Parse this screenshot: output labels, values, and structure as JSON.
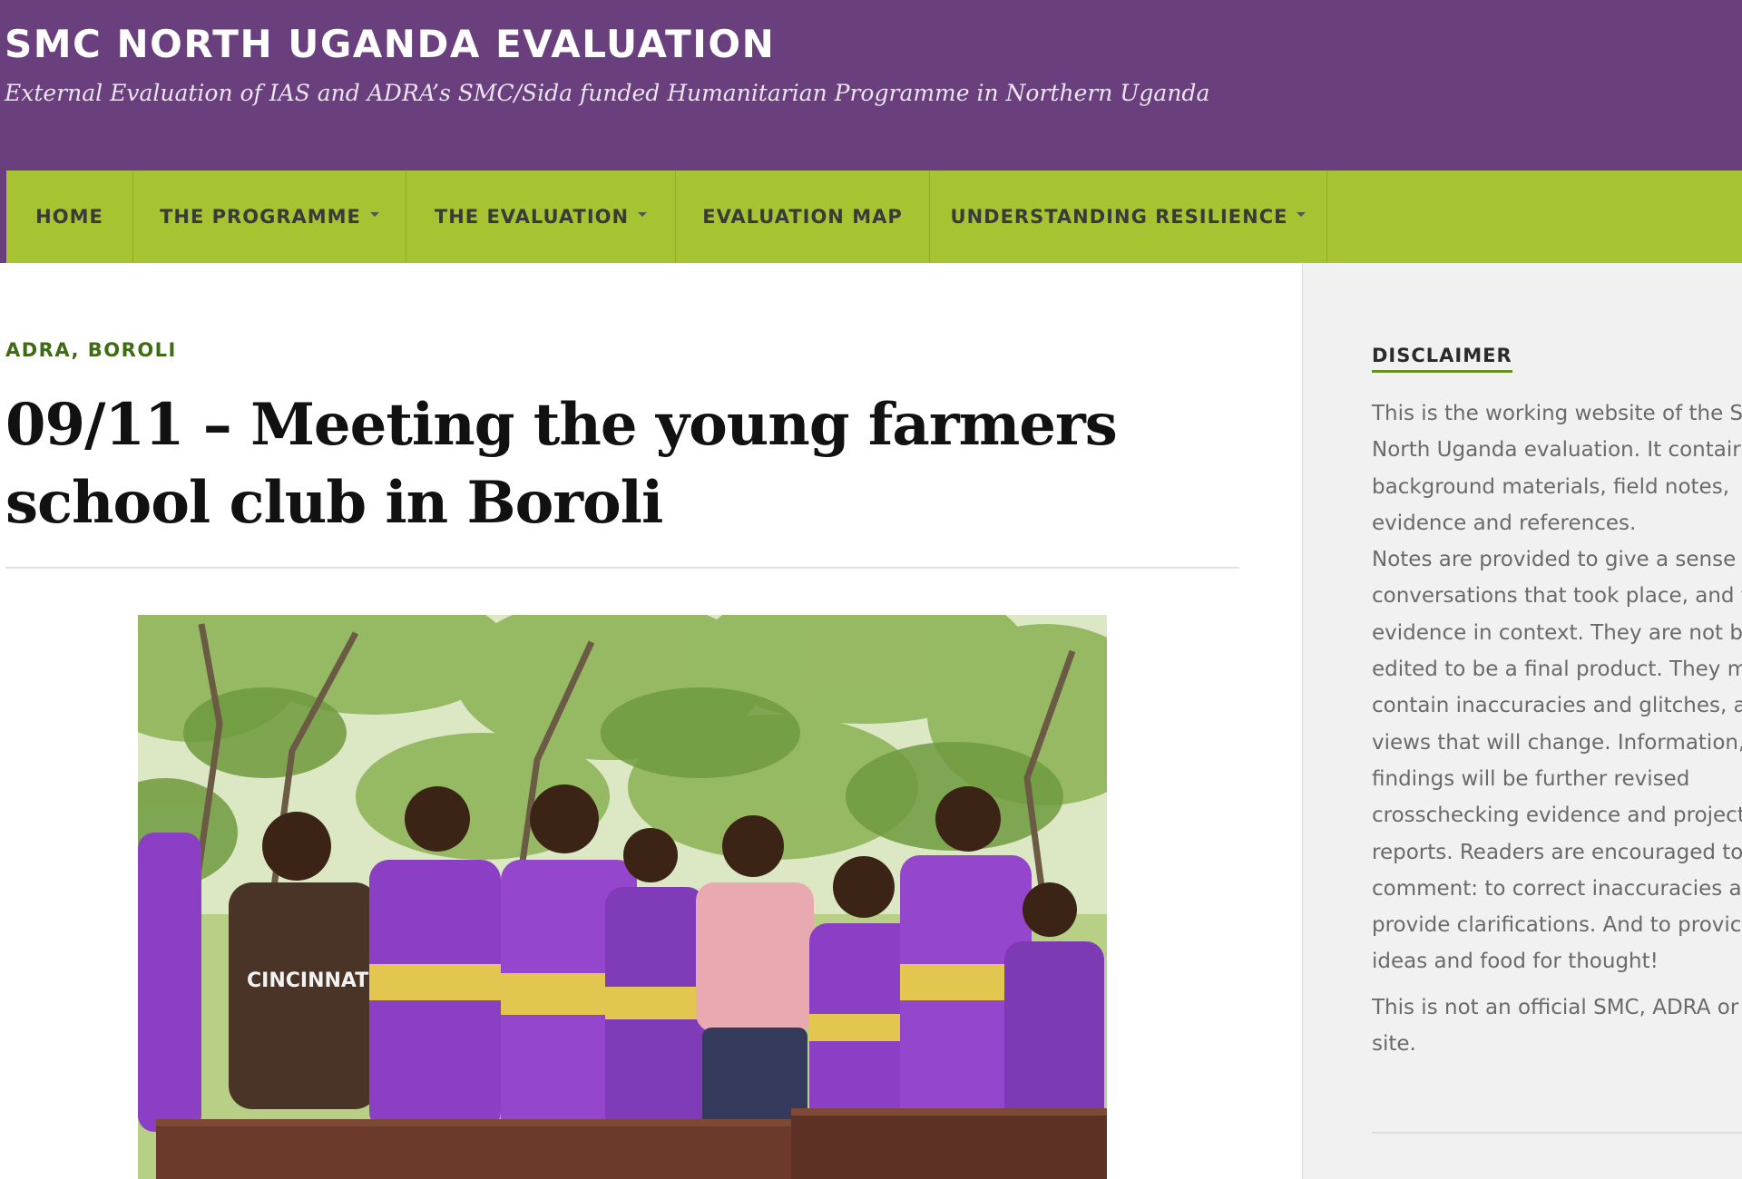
{
  "header": {
    "site_title": "SMC NORTH UGANDA EVALUATION",
    "tagline": "External Evaluation of IAS and ADRA’s SMC/Sida funded Humanitarian Programme in Northern Uganda",
    "background_color": "#6a3f7e"
  },
  "nav": {
    "background_color": "#a6c332",
    "items": [
      {
        "label": "HOME",
        "has_submenu": false
      },
      {
        "label": "THE PROGRAMME",
        "has_submenu": true
      },
      {
        "label": "THE EVALUATION",
        "has_submenu": true
      },
      {
        "label": "EVALUATION MAP",
        "has_submenu": false
      },
      {
        "label": "UNDERSTANDING RESILIENCE",
        "has_submenu": true
      }
    ]
  },
  "post": {
    "categories": [
      "ADRA",
      "BOROLI"
    ],
    "category_separator": ", ",
    "title_line1": "09/11 – Meeting the young farmers",
    "title_line2": "school club in Boroli",
    "image": {
      "alt": "Students of the young farmers school club in purple uniforms with yellow sashes standing at wooden desks under trees",
      "shirt_text": "CINCINNATI"
    }
  },
  "sidebar": {
    "widget_title": "DISCLAIMER",
    "lines_p1": [
      "This is the working website of the S",
      "North Uganda evaluation. It contair",
      "background materials, field notes,",
      "evidence and references.",
      "Notes are provided to give a sense c",
      "conversations that took place, and t",
      "evidence in context. They are not be",
      "edited to be a final product. They mi",
      "contain inaccuracies and glitches, ar",
      "views that will change. Information,",
      "findings will be further revised",
      "crosschecking evidence and project",
      "reports. Readers are encouraged to",
      "comment: to correct inaccuracies ar",
      "provide clarifications. And to provic",
      "ideas and food for thought!"
    ],
    "lines_p2": [
      "This is not an official SMC, ADRA or",
      "site."
    ]
  },
  "colors": {
    "category_green": "#3f6b14",
    "sidebar_bg": "#f1f1f1",
    "uniform_purple": "#8a3fc4",
    "sash_yellow": "#e3c64f"
  }
}
